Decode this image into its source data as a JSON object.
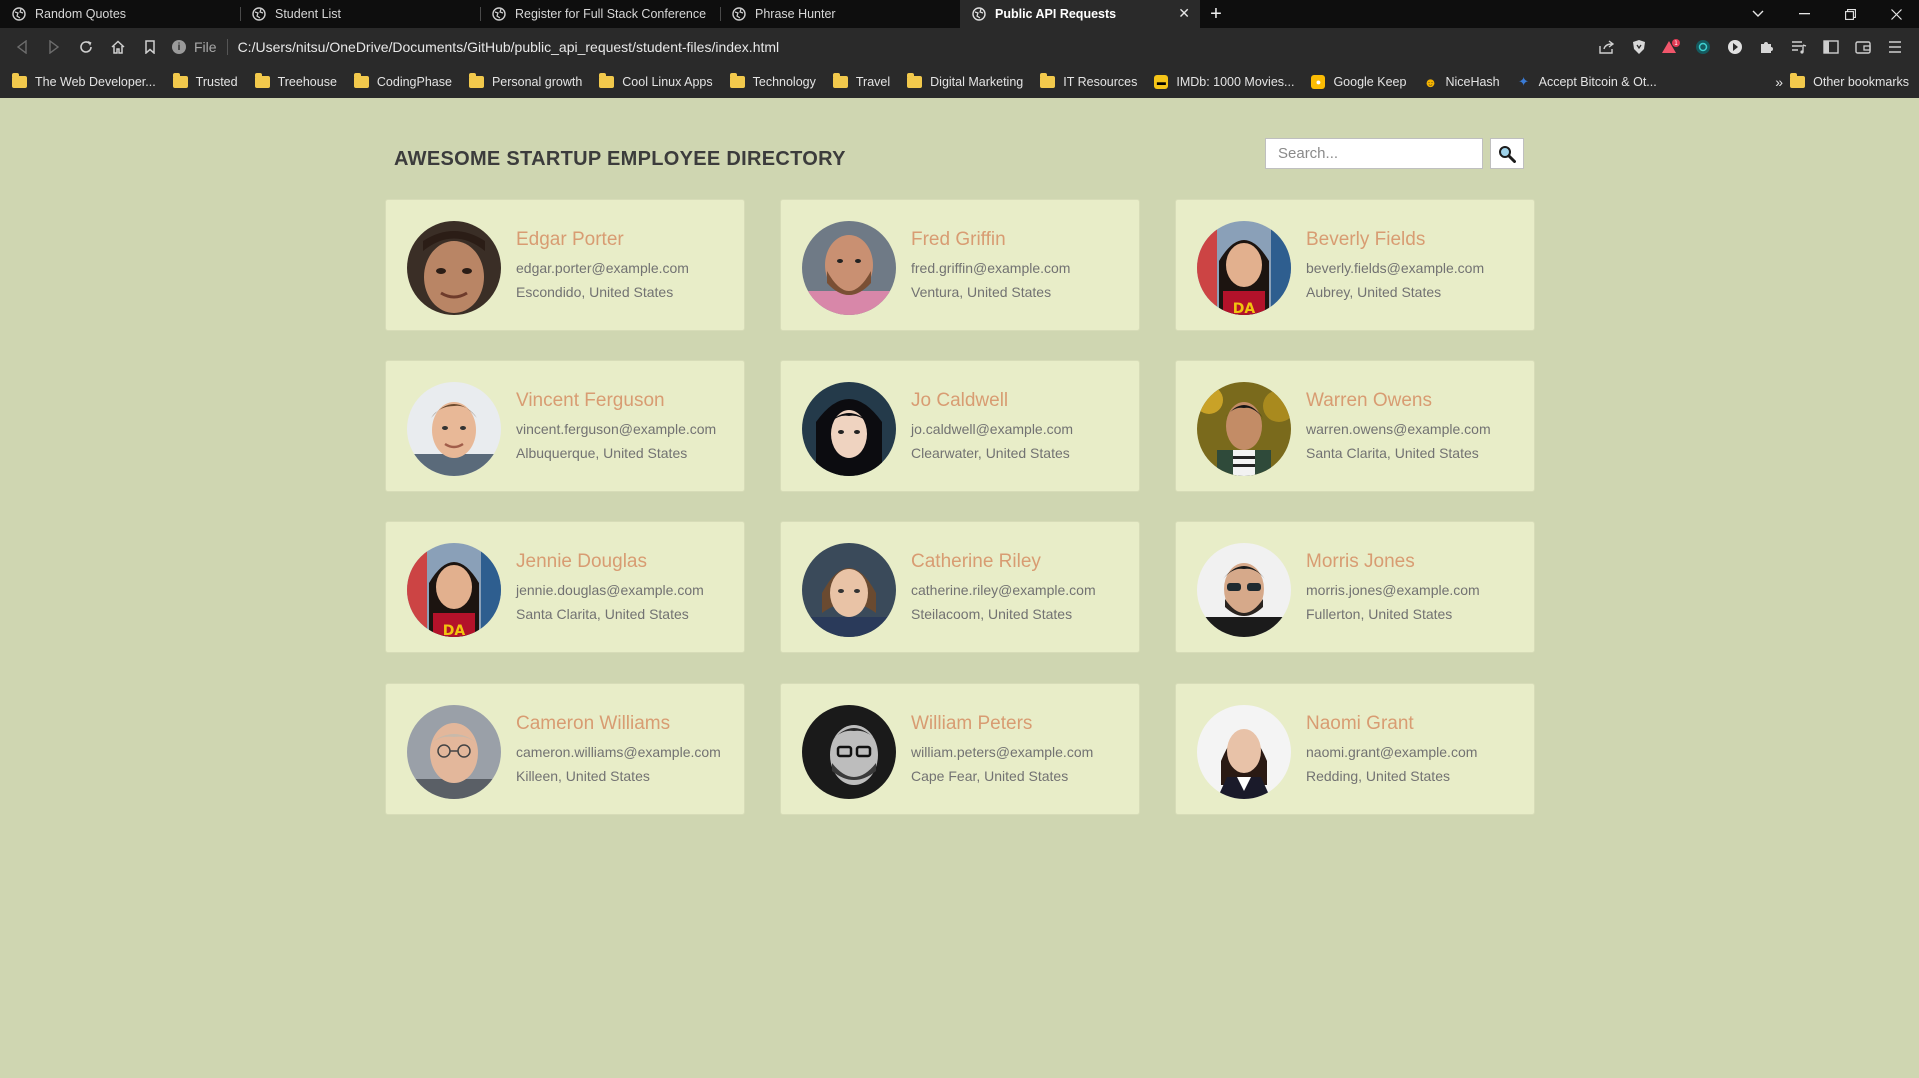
{
  "browser": {
    "tabs": [
      {
        "title": "Random Quotes",
        "active": false
      },
      {
        "title": "Student List",
        "active": false
      },
      {
        "title": "Register for Full Stack Conference",
        "active": false
      },
      {
        "title": "Phrase Hunter",
        "active": false
      },
      {
        "title": "Public API Requests",
        "active": true
      }
    ],
    "new_tab_label": "+",
    "tab_close_label": "✕",
    "url_scheme": "File",
    "url": "C:/Users/nitsu/OneDrive/Documents/GitHub/public_api_request/student-files/index.html",
    "bookmarks": [
      {
        "label": "The Web Developer...",
        "icon": "folder-icon"
      },
      {
        "label": "Trusted",
        "icon": "folder-icon"
      },
      {
        "label": "Treehouse",
        "icon": "folder-icon"
      },
      {
        "label": "CodingPhase",
        "icon": "folder-icon"
      },
      {
        "label": "Personal growth",
        "icon": "folder-icon"
      },
      {
        "label": "Cool Linux Apps",
        "icon": "folder-icon"
      },
      {
        "label": "Technology",
        "icon": "folder-icon"
      },
      {
        "label": "Travel",
        "icon": "folder-icon"
      },
      {
        "label": "Digital Marketing",
        "icon": "folder-icon"
      },
      {
        "label": "IT Resources",
        "icon": "folder-icon"
      },
      {
        "label": "IMDb: 1000 Movies...",
        "icon": "imdb-icon"
      },
      {
        "label": "Google Keep",
        "icon": "google-keep-icon"
      },
      {
        "label": "NiceHash",
        "icon": "nicehash-icon"
      },
      {
        "label": "Accept Bitcoin & Ot...",
        "icon": "bitcoin-icon"
      }
    ],
    "bookmarks_more": "»",
    "other_bookmarks": "Other bookmarks"
  },
  "page": {
    "title": "AWESOME STARTUP EMPLOYEE DIRECTORY",
    "search": {
      "placeholder": "Search...",
      "value": ""
    },
    "colors": {
      "background": "#cfd6b1",
      "card": "#e8edc8",
      "name": "#d89c72",
      "text": "#727272"
    }
  },
  "employees": [
    {
      "name": "Edgar Porter",
      "email": "edgar.porter@example.com",
      "location": "Escondido, United States"
    },
    {
      "name": "Fred Griffin",
      "email": "fred.griffin@example.com",
      "location": "Ventura, United States"
    },
    {
      "name": "Beverly Fields",
      "email": "beverly.fields@example.com",
      "location": "Aubrey, United States"
    },
    {
      "name": "Vincent Ferguson",
      "email": "vincent.ferguson@example.com",
      "location": "Albuquerque, United States"
    },
    {
      "name": "Jo Caldwell",
      "email": "jo.caldwell@example.com",
      "location": "Clearwater, United States"
    },
    {
      "name": "Warren Owens",
      "email": "warren.owens@example.com",
      "location": "Santa Clarita, United States"
    },
    {
      "name": "Jennie Douglas",
      "email": "jennie.douglas@example.com",
      "location": "Santa Clarita, United States"
    },
    {
      "name": "Catherine Riley",
      "email": "catherine.riley@example.com",
      "location": "Steilacoom, United States"
    },
    {
      "name": "Morris Jones",
      "email": "morris.jones@example.com",
      "location": "Fullerton, United States"
    },
    {
      "name": "Cameron Williams",
      "email": "cameron.williams@example.com",
      "location": "Killeen, United States"
    },
    {
      "name": "William Peters",
      "email": "william.peters@example.com",
      "location": "Cape Fear, United States"
    },
    {
      "name": "Naomi Grant",
      "email": "naomi.grant@example.com",
      "location": "Redding, United States"
    }
  ]
}
